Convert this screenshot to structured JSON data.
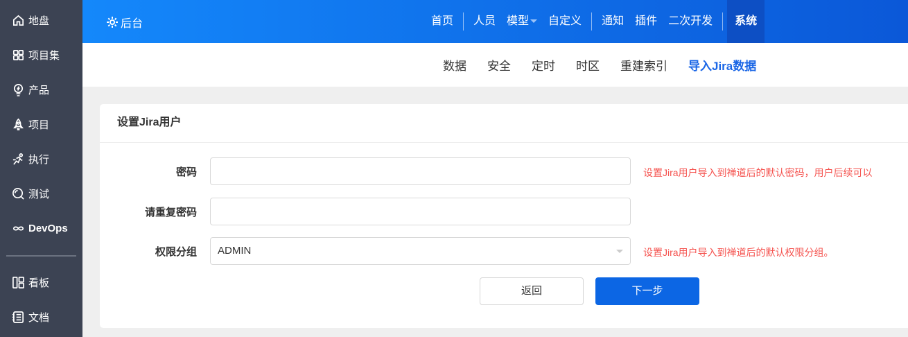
{
  "sidebar": {
    "items": [
      {
        "label": "地盘",
        "icon": "home-icon"
      },
      {
        "label": "项目集",
        "icon": "grid-icon"
      },
      {
        "label": "产品",
        "icon": "bulb-icon"
      },
      {
        "label": "项目",
        "icon": "rocket-icon"
      },
      {
        "label": "执行",
        "icon": "run-icon"
      },
      {
        "label": "测试",
        "icon": "search-icon"
      },
      {
        "label": "DevOps",
        "icon": "infinity-icon"
      },
      {
        "label": "看板",
        "icon": "kanban-icon"
      },
      {
        "label": "文档",
        "icon": "doc-icon"
      }
    ]
  },
  "topbar": {
    "brand": "后台",
    "nav": [
      "首页",
      "人员",
      "模型",
      "自定义",
      "通知",
      "插件",
      "二次开发",
      "系统"
    ]
  },
  "subnav": [
    "数据",
    "安全",
    "定时",
    "时区",
    "重建索引",
    "导入Jira数据"
  ],
  "card": {
    "title": "设置Jira用户",
    "password_label": "密码",
    "password_value": "",
    "password_hint": "设置Jira用户导入到禅道后的默认密码，用户后续可以",
    "repeat_label": "请重复密码",
    "repeat_value": "",
    "group_label": "权限分组",
    "group_value": "ADMIN",
    "group_hint": "设置Jira用户导入到禅道后的默认权限分组。",
    "back_label": "返回",
    "next_label": "下一步"
  },
  "colors": {
    "sidebar": "#3c4353",
    "primary": "#0c66e4",
    "hint": "#f5534f"
  }
}
